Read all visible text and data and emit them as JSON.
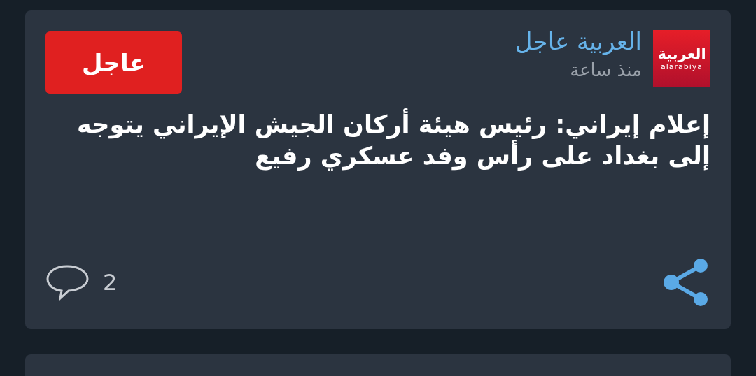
{
  "posts": [
    {
      "source": {
        "name": "العربية عاجل",
        "logo_text": "العربية",
        "logo_subtext": "alarabiya"
      },
      "time": "منذ ساعة",
      "badge": "عاجل",
      "headline": "إعلام إيراني: رئيس هيئة أركان الجيش الإيراني يتوجه إلى بغداد على رأس وفد عسكري رفيع",
      "comments": "2"
    }
  ]
}
